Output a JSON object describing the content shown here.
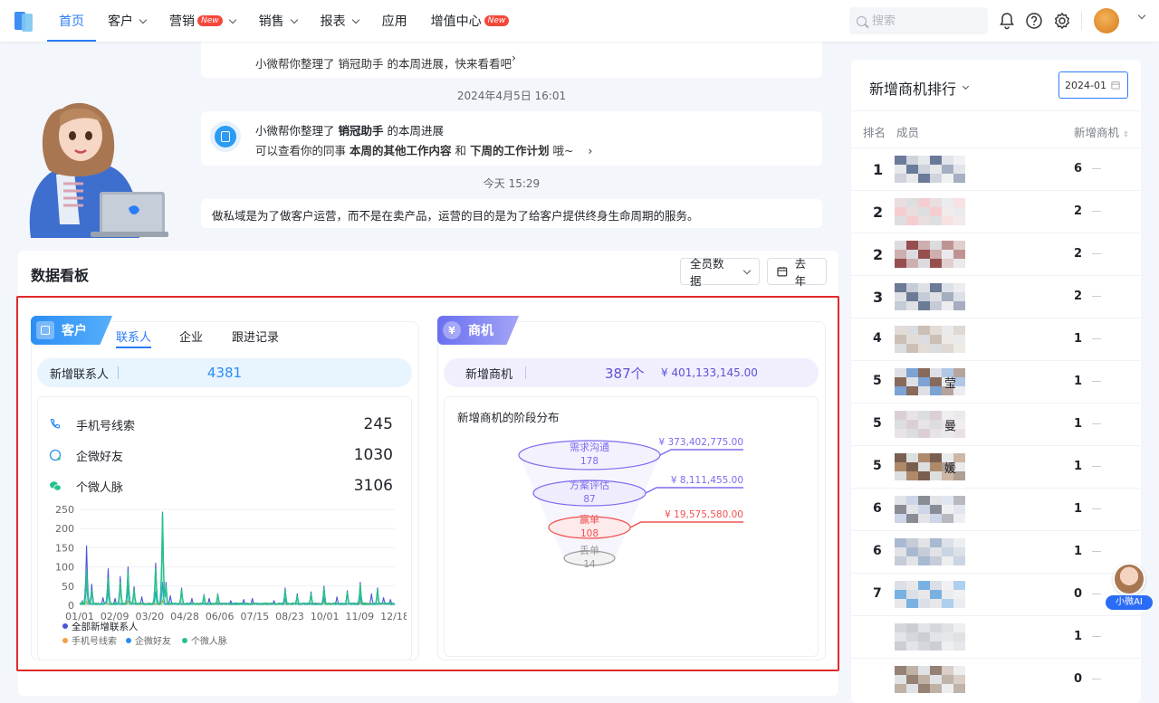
{
  "nav": {
    "items": [
      {
        "label": "首页",
        "active": true,
        "dropdown": false,
        "badge": ""
      },
      {
        "label": "客户",
        "active": false,
        "dropdown": true,
        "badge": ""
      },
      {
        "label": "营销",
        "active": false,
        "dropdown": true,
        "badge": "New"
      },
      {
        "label": "销售",
        "active": false,
        "dropdown": true,
        "badge": ""
      },
      {
        "label": "报表",
        "active": false,
        "dropdown": true,
        "badge": ""
      },
      {
        "label": "应用",
        "active": false,
        "dropdown": false,
        "badge": ""
      },
      {
        "label": "增值中心",
        "active": false,
        "dropdown": false,
        "badge": "New"
      }
    ],
    "search_placeholder": "搜索",
    "icons": [
      "bell-icon",
      "help-icon",
      "gear-icon"
    ],
    "accent": "#2b7cf6"
  },
  "feed": {
    "msg0_text": "小微帮你整理了 销冠助手 的本周进展，快来看看吧",
    "ts1": "2024年4月5日 16:01",
    "msg1_title_a": "小微帮你整理了 ",
    "msg1_title_b": "销冠助手",
    "msg1_title_c": " 的本周进展",
    "msg1_line_a": "可以查看你的同事 ",
    "msg1_line_b": "本周的其他工作内容",
    "msg1_line_c": " 和 ",
    "msg1_line_d": "下周的工作计划",
    "msg1_line_e": " 哦~",
    "ts2": "今天 15:29",
    "msg2_text": "做私域是为了做客户运营，而不是在卖产品，运营的目的是为了给客户提供终身生命周期的服务。"
  },
  "dashboard": {
    "title": "数据看板",
    "scope_select": "全员数据",
    "period_button": "去年"
  },
  "customer": {
    "tab_label": "客户",
    "subtabs": [
      "联系人",
      "企业",
      "跟进记录"
    ],
    "active_subtab": 0,
    "new_label": "新增联系人",
    "new_value": "4381",
    "rows": [
      {
        "icon": "phone-icon",
        "label": "手机号线索",
        "value": "245"
      },
      {
        "icon": "wecom-icon",
        "label": "企微好友",
        "value": "1030"
      },
      {
        "icon": "wechat-icon",
        "label": "个微人脉",
        "value": "3106"
      }
    ]
  },
  "opportunity": {
    "tab_label": "商机",
    "new_label": "新增商机",
    "new_count": "387个",
    "new_amount": "¥ 401,133,145.00",
    "funnel_title": "新增商机的阶段分布",
    "stages": [
      {
        "name": "需求沟通",
        "count": "178",
        "amount": "¥ 373,402,775.00",
        "color": "#7a6cf0"
      },
      {
        "name": "方案评估",
        "count": "87",
        "amount": "¥ 8,111,455.00",
        "color": "#7a6cf0"
      },
      {
        "name": "赢单",
        "count": "108",
        "amount": "¥ 19,575,580.00",
        "color": "#f05252"
      },
      {
        "name": "丢单",
        "count": "14",
        "amount": "",
        "color": "#999999"
      }
    ]
  },
  "chart_data": {
    "type": "line",
    "x_tick_labels": [
      "01/01",
      "02/09",
      "03/20",
      "04/28",
      "06/06",
      "07/15",
      "08/23",
      "10/01",
      "11/09",
      "12/18"
    ],
    "y_tick_labels": [
      "0",
      "50",
      "100",
      "150",
      "200",
      "250"
    ],
    "ylim": [
      0,
      250
    ],
    "n_days": 366,
    "series": [
      {
        "name": "全部新增联系人",
        "color": "#4a55d6",
        "peaks": [
          [
            3,
            12
          ],
          [
            8,
            155
          ],
          [
            14,
            55
          ],
          [
            27,
            20
          ],
          [
            33,
            95
          ],
          [
            41,
            18
          ],
          [
            47,
            75
          ],
          [
            56,
            100
          ],
          [
            63,
            48
          ],
          [
            72,
            22
          ],
          [
            88,
            110
          ],
          [
            96,
            243
          ],
          [
            100,
            60
          ],
          [
            105,
            25
          ],
          [
            118,
            45
          ],
          [
            130,
            18
          ],
          [
            144,
            28
          ],
          [
            150,
            18
          ],
          [
            160,
            30
          ],
          [
            175,
            12
          ],
          [
            190,
            15
          ],
          [
            200,
            18
          ],
          [
            225,
            12
          ],
          [
            238,
            45
          ],
          [
            252,
            30
          ],
          [
            268,
            35
          ],
          [
            283,
            50
          ],
          [
            298,
            22
          ],
          [
            310,
            38
          ],
          [
            325,
            60
          ],
          [
            338,
            30
          ],
          [
            345,
            45
          ],
          [
            352,
            20
          ],
          [
            360,
            15
          ]
        ]
      },
      {
        "name": "手机号线索",
        "color": "#f5a04a",
        "peaks": [
          [
            8,
            10
          ],
          [
            56,
            12
          ],
          [
            96,
            14
          ],
          [
            160,
            8
          ],
          [
            283,
            9
          ],
          [
            325,
            10
          ]
        ]
      },
      {
        "name": "企微好友",
        "color": "#2b8cf0",
        "peaks": [
          [
            8,
            60
          ],
          [
            33,
            40
          ],
          [
            56,
            45
          ],
          [
            88,
            35
          ],
          [
            96,
            60
          ],
          [
            238,
            18
          ],
          [
            283,
            20
          ],
          [
            325,
            25
          ]
        ]
      },
      {
        "name": "个微人脉",
        "color": "#25c28b",
        "peaks": [
          [
            3,
            10
          ],
          [
            8,
            90
          ],
          [
            14,
            40
          ],
          [
            33,
            70
          ],
          [
            47,
            60
          ],
          [
            56,
            85
          ],
          [
            63,
            40
          ],
          [
            88,
            95
          ],
          [
            96,
            240
          ],
          [
            100,
            50
          ],
          [
            118,
            40
          ],
          [
            144,
            25
          ],
          [
            160,
            28
          ],
          [
            238,
            40
          ],
          [
            252,
            25
          ],
          [
            268,
            30
          ],
          [
            283,
            45
          ],
          [
            310,
            35
          ],
          [
            325,
            55
          ],
          [
            345,
            40
          ]
        ]
      }
    ]
  },
  "rank": {
    "title": "新增商机排行",
    "date": "2024-01",
    "col_rank": "排名",
    "col_member": "成员",
    "col_value": "新增商机",
    "rows": [
      {
        "rank": "1",
        "value": "6",
        "name_tail": ""
      },
      {
        "rank": "2",
        "value": "2",
        "name_tail": ""
      },
      {
        "rank": "2",
        "value": "2",
        "name_tail": ""
      },
      {
        "rank": "3",
        "value": "2",
        "name_tail": ""
      },
      {
        "rank": "4",
        "value": "1",
        "name_tail": ""
      },
      {
        "rank": "5",
        "value": "1",
        "name_tail": "莹"
      },
      {
        "rank": "5",
        "value": "1",
        "name_tail": "曼"
      },
      {
        "rank": "5",
        "value": "1",
        "name_tail": "媛"
      },
      {
        "rank": "6",
        "value": "1",
        "name_tail": ""
      },
      {
        "rank": "6",
        "value": "1",
        "name_tail": ""
      },
      {
        "rank": "7",
        "value": "0",
        "name_tail": ""
      },
      {
        "rank": "",
        "value": "1",
        "name_tail": ""
      },
      {
        "rank": "",
        "value": "0",
        "name_tail": ""
      }
    ]
  },
  "ai_badge": {
    "label": "小微AI"
  }
}
